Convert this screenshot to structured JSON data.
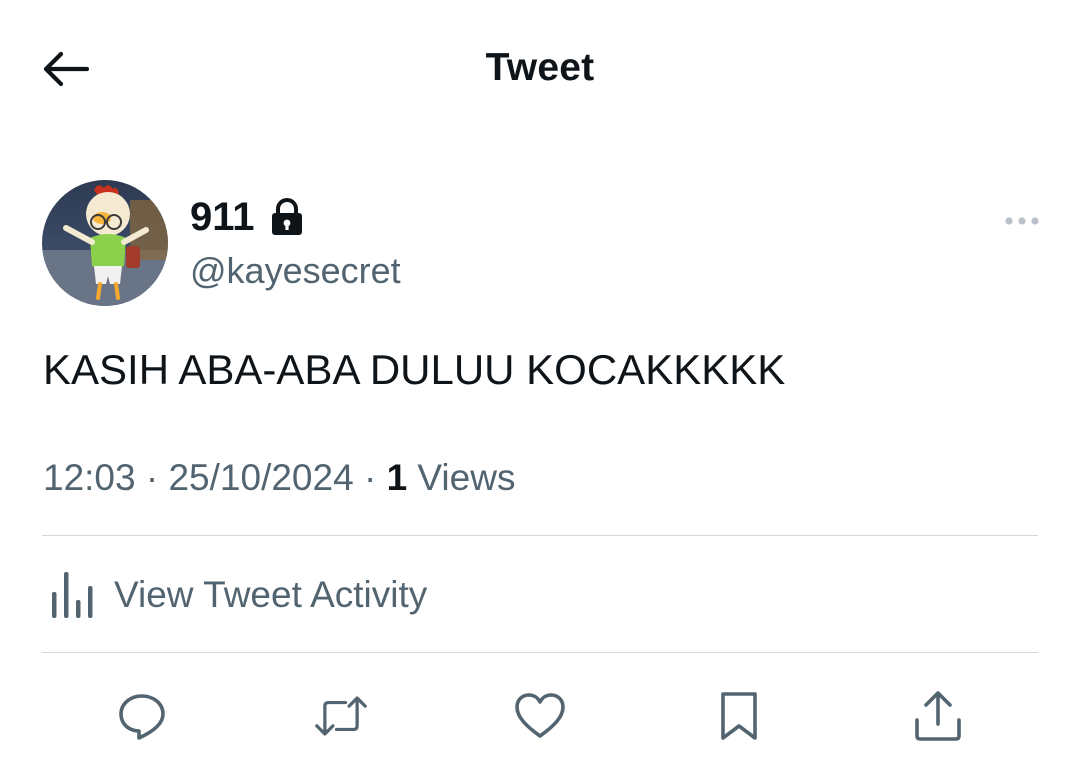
{
  "header": {
    "title": "Tweet",
    "back_icon": "arrow-left-icon"
  },
  "author": {
    "display_name": "911",
    "handle": "@kayesecret",
    "protected_icon": "lock-icon",
    "avatar_icon": "cartoon-chicken-avatar"
  },
  "tweet": {
    "text": "KASIH ABA-ABA DULUU KOCAKKKKK",
    "time": "12:03",
    "separator": "·",
    "date": "25/10/2024",
    "views_count": "1",
    "views_label": "Views"
  },
  "activity": {
    "label": "View Tweet Activity",
    "icon": "bar-chart-icon"
  },
  "actions": {
    "reply_icon": "reply-icon",
    "retweet_icon": "retweet-icon",
    "like_icon": "heart-icon",
    "bookmark_icon": "bookmark-icon",
    "share_icon": "share-icon"
  },
  "colors": {
    "text_primary": "#0f1419",
    "text_secondary": "#536471",
    "divider": "#cfd9de"
  }
}
